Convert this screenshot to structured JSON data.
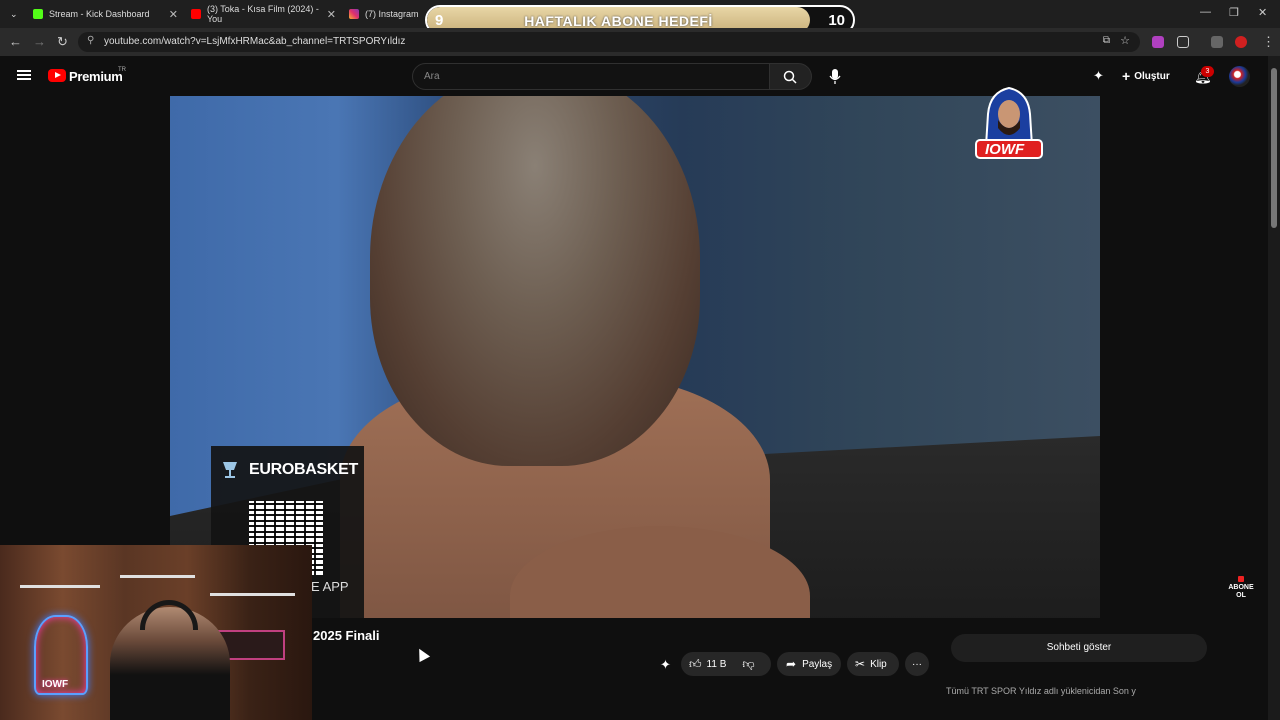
{
  "browser": {
    "tabs": [
      {
        "label": "Stream - Kick Dashboard",
        "icon": "kick-icon"
      },
      {
        "label": "(3) Toka - Kısa Film (2024) - You",
        "icon": "youtube-icon"
      },
      {
        "label": "(7) Instagram",
        "icon": "instagram-icon"
      }
    ],
    "url": "youtube.com/watch?v=LsjMfxHRMac&ab_channel=TRTSPORYıldız"
  },
  "overlay": {
    "goal_label": "HAFTALIK ABONE HEDEFİ",
    "current": "9",
    "target": "10",
    "progress": 0.9,
    "badge_text": "IOWF",
    "abone_text": "ABONE OL",
    "neon_text": "IOWF"
  },
  "youtube": {
    "brand": "Premium",
    "region": "TR",
    "search_placeholder": "Ara",
    "create_label": "Oluştur",
    "notifications": "3"
  },
  "video": {
    "title": "2025 Finali",
    "sponsor": "EUROBASKET",
    "sponsor_app": "E APP",
    "likes": "11 B",
    "share_label": "Paylaş",
    "clip_label": "Klip",
    "more_label": "···",
    "chat_toggle": "Sohbeti göster",
    "chat_strip": "Tümü   TRT SPOR Yıldız adlı yüklenicidan   Son y"
  },
  "colors": {
    "accent": "#ff0000",
    "goal_fill": "#e8d6a6",
    "background": "#0f0f0f"
  }
}
